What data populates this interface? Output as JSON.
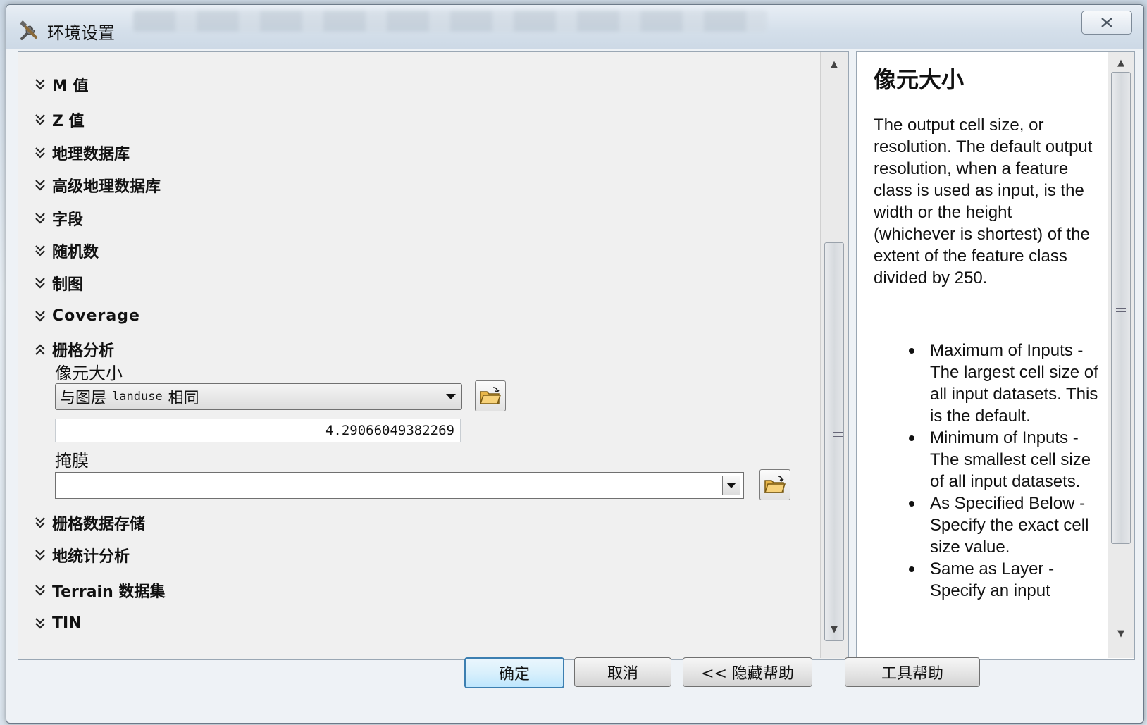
{
  "window": {
    "title": "环境设置",
    "close_label": "☒"
  },
  "categories": [
    {
      "label": "M 值",
      "state": "collapsed"
    },
    {
      "label": "Z 值",
      "state": "collapsed"
    },
    {
      "label": "地理数据库",
      "state": "collapsed"
    },
    {
      "label": "高级地理数据库",
      "state": "collapsed"
    },
    {
      "label": "字段",
      "state": "collapsed"
    },
    {
      "label": "随机数",
      "state": "collapsed"
    },
    {
      "label": "制图",
      "state": "collapsed"
    },
    {
      "label": "Coverage",
      "state": "collapsed"
    },
    {
      "label": "栅格分析",
      "state": "expanded"
    },
    {
      "label": "栅格数据存储",
      "state": "collapsed"
    },
    {
      "label": "地统计分析",
      "state": "collapsed"
    },
    {
      "label": "Terrain 数据集",
      "state": "collapsed"
    },
    {
      "label": "TIN",
      "state": "collapsed"
    }
  ],
  "raster_analysis": {
    "cell_size_label": "像元大小",
    "cell_size_option_prefix": "与图层",
    "cell_size_option_layer": "landuse",
    "cell_size_option_suffix": "相同",
    "cell_size_value": "4.29066049382269",
    "mask_label": "掩膜",
    "mask_value": ""
  },
  "help": {
    "title": "像元大小",
    "intro": "The output cell size, or resolution. The default output resolution, when a feature class is used as input, is the width or the height (whichever is shortest) of the extent of the feature class divided by 250.",
    "items": [
      "Maximum of Inputs - The largest cell size of all input datasets. This is the default.",
      "Minimum of Inputs - The smallest cell size of all input datasets.",
      "As Specified Below - Specify the exact cell size value.",
      "Same as Layer - Specify an input"
    ]
  },
  "buttons": {
    "ok": "确定",
    "cancel": "取消",
    "hide_help": "<< 隐藏帮助",
    "tool_help": "工具帮助"
  }
}
